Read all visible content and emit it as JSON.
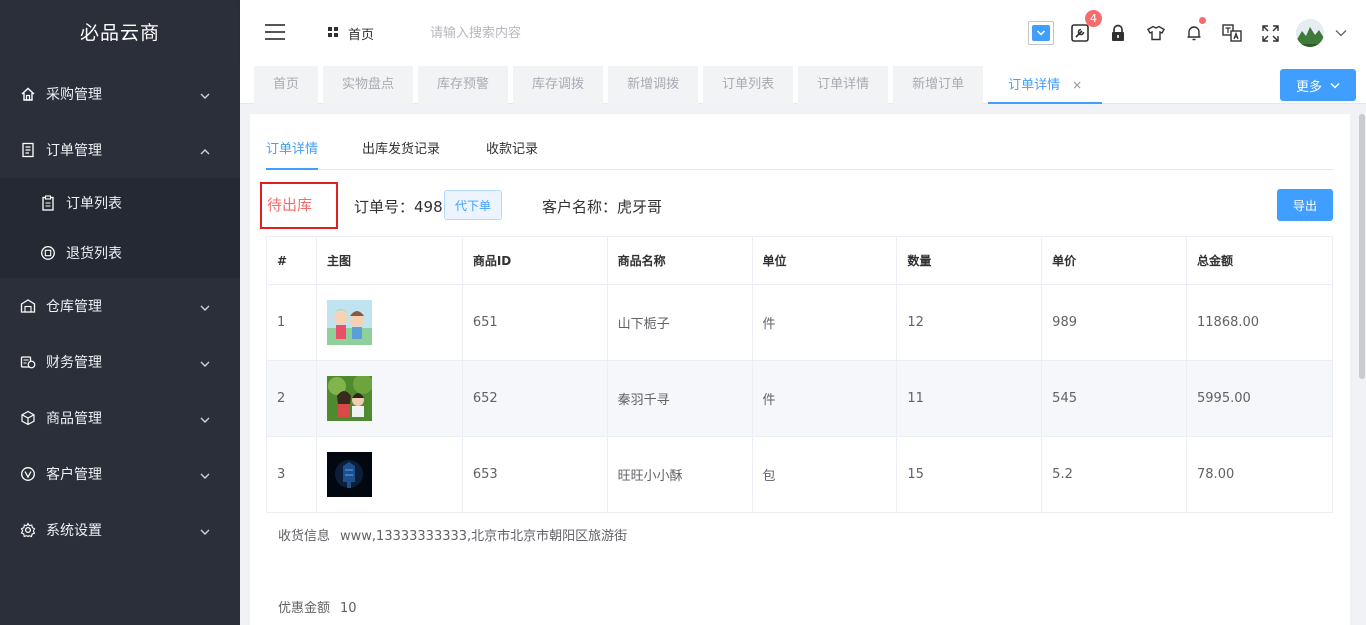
{
  "app": {
    "title": "必品云商"
  },
  "sidebar": {
    "menus": [
      {
        "label": "采购管理",
        "icon": "home-icon",
        "expanded": false
      },
      {
        "label": "订单管理",
        "icon": "document-icon",
        "expanded": true,
        "children": [
          {
            "label": "订单列表",
            "icon": "clipboard-icon"
          },
          {
            "label": "退货列表",
            "icon": "return-icon"
          }
        ]
      },
      {
        "label": "仓库管理",
        "icon": "warehouse-icon",
        "expanded": false
      },
      {
        "label": "财务管理",
        "icon": "finance-icon",
        "expanded": false
      },
      {
        "label": "商品管理",
        "icon": "box-icon",
        "expanded": false
      },
      {
        "label": "客户管理",
        "icon": "customer-icon",
        "expanded": false
      },
      {
        "label": "系统设置",
        "icon": "gear-icon",
        "expanded": false
      }
    ]
  },
  "header": {
    "breadcrumb": "首页",
    "search_placeholder": "请输入搜索内容",
    "notification_count": "4"
  },
  "tabs": [
    {
      "label": "首页"
    },
    {
      "label": "实物盘点"
    },
    {
      "label": "库存预警"
    },
    {
      "label": "库存调拨"
    },
    {
      "label": "新增调拨"
    },
    {
      "label": "订单列表"
    },
    {
      "label": "订单详情"
    },
    {
      "label": "新增订单"
    },
    {
      "label": "订单详情",
      "active": true
    }
  ],
  "more_label": "更多",
  "subtabs": [
    {
      "label": "订单详情",
      "active": true
    },
    {
      "label": "出库发货记录"
    },
    {
      "label": "收款记录"
    }
  ],
  "order": {
    "status": "待出库",
    "number_text": "订单号：498",
    "proxy_button": "代下单",
    "customer_text": "客户名称：虎牙哥",
    "export_button": "导出"
  },
  "table": {
    "headers": [
      "#",
      "主图",
      "商品ID",
      "商品名称",
      "单位",
      "数量",
      "单价",
      "总金额"
    ],
    "rows": [
      {
        "idx": "1",
        "id": "651",
        "name": "山下栀子",
        "unit": "件",
        "qty": "12",
        "price": "989",
        "total": "11868.00"
      },
      {
        "idx": "2",
        "id": "652",
        "name": "秦羽千寻",
        "unit": "件",
        "qty": "11",
        "price": "545",
        "total": "5995.00"
      },
      {
        "idx": "3",
        "id": "653",
        "name": "旺旺小小酥",
        "unit": "包",
        "qty": "15",
        "price": "5.2",
        "total": "78.00"
      }
    ]
  },
  "shipping": {
    "label": "收货信息",
    "value": "www,13333333333,北京市北京市朝阳区旅游街"
  },
  "discount": {
    "label": "优惠金额",
    "value": "10"
  },
  "colors": {
    "sidebar_bg": "#2b2f3a",
    "accent": "#409eff",
    "danger": "#f56c6c"
  }
}
